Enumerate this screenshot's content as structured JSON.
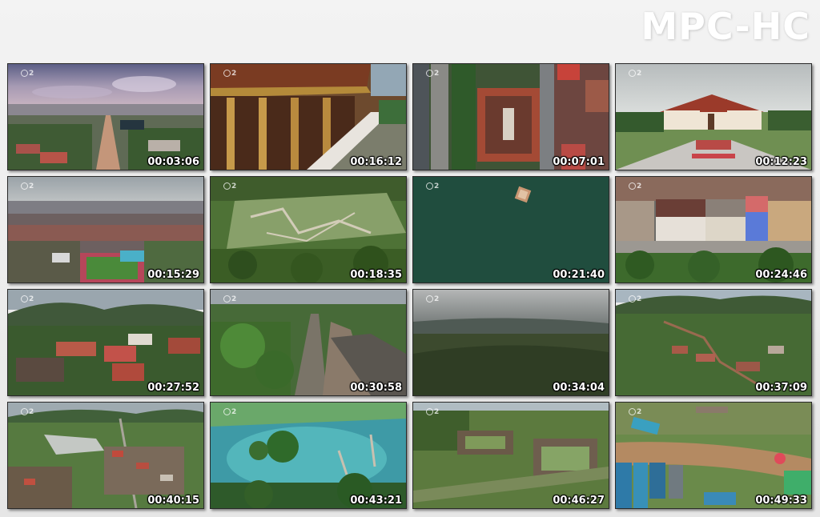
{
  "app": {
    "logo": "MPC-HC"
  },
  "thumbnails": [
    {
      "timecode": "00:03:06",
      "scene": "city-street-overview",
      "channel_logo": "2"
    },
    {
      "timecode": "00:16:12",
      "scene": "temple-roof-closeup",
      "channel_logo": "2"
    },
    {
      "timecode": "00:07:01",
      "scene": "temple-courtyard-topdown",
      "channel_logo": "2"
    },
    {
      "timecode": "00:12:23",
      "scene": "palace-museum-front",
      "channel_logo": "2"
    },
    {
      "timecode": "00:15:29",
      "scene": "city-panorama-stadium",
      "channel_logo": "2"
    },
    {
      "timecode": "00:18:35",
      "scene": "garden-ruins-aerial",
      "channel_logo": "2"
    },
    {
      "timecode": "00:21:40",
      "scene": "river-boat",
      "channel_logo": "2"
    },
    {
      "timecode": "00:24:46",
      "scene": "townhouses-street",
      "channel_logo": "2"
    },
    {
      "timecode": "00:27:52",
      "scene": "hillside-town",
      "channel_logo": "2"
    },
    {
      "timecode": "00:30:58",
      "scene": "tree-lined-street",
      "channel_logo": "2"
    },
    {
      "timecode": "00:34:04",
      "scene": "forest-mountains",
      "channel_logo": "2"
    },
    {
      "timecode": "00:37:09",
      "scene": "village-valley",
      "channel_logo": "2"
    },
    {
      "timecode": "00:40:15",
      "scene": "town-fields",
      "channel_logo": "2"
    },
    {
      "timecode": "00:43:21",
      "scene": "turquoise-lagoon",
      "channel_logo": "2"
    },
    {
      "timecode": "00:46:27",
      "scene": "stone-ruins-field",
      "channel_logo": "2"
    },
    {
      "timecode": "00:49:33",
      "scene": "bus-station-aerial",
      "channel_logo": "2"
    }
  ],
  "colors": {
    "background": "#ececec",
    "logo_text": "#ffffff",
    "timecode_text": "#ffffff"
  }
}
